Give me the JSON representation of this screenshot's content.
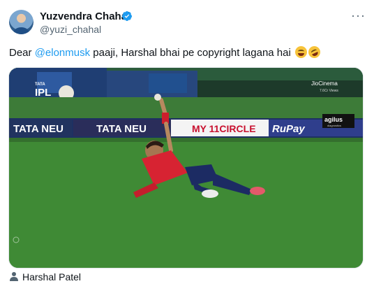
{
  "author": {
    "name": "Yuzvendra Chahal",
    "handle": "@yuzi_chahal",
    "verified_color": "#1d9bf0"
  },
  "post": {
    "text_prefix": "Dear ",
    "mention": "@elonmusk",
    "text_suffix": " paaji, Harshal bhai pe copyright lagana hai",
    "emojis": [
      "joy-emoji",
      "rofl-emoji"
    ],
    "more_label": "···"
  },
  "media": {
    "banner_labels": [
      "TATA NEU",
      "TATA NEU",
      "MY 11CIRCLE",
      "RuPay"
    ],
    "logo_text": "IPL",
    "logo_top": "TATA",
    "broadcaster": "JioCinema",
    "broadcaster_sub": "7.6Cr Views",
    "sponsor": "agilus",
    "sponsor_sub": "diagnostics"
  },
  "tag": {
    "label": "Harshal Patel"
  }
}
